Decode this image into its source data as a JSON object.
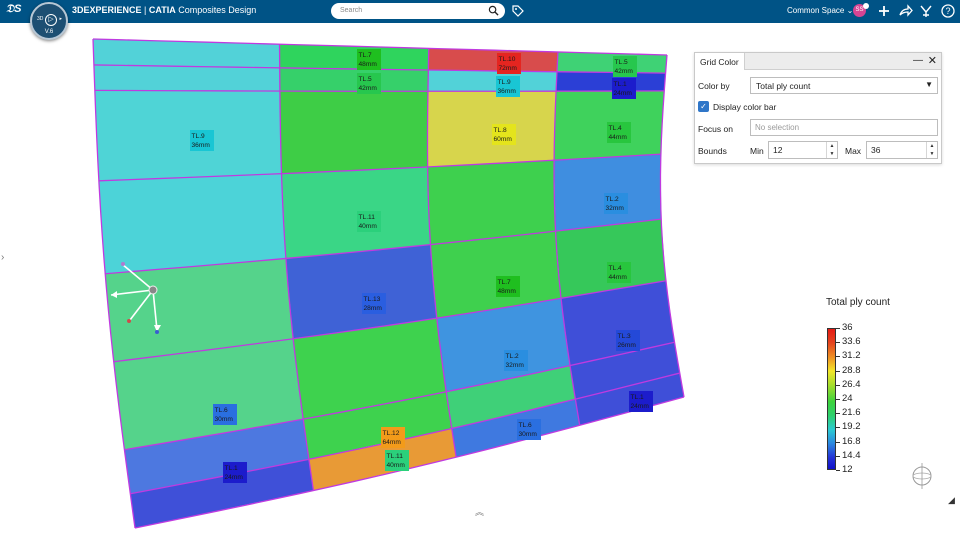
{
  "header": {
    "brand_bold": "3DEXPERIENCE",
    "brand_sep": " | ",
    "brand_app": "CATIA",
    "brand_module": " Composites Design",
    "search_placeholder": "Search",
    "space_label": "Common Space",
    "avatar_initials": "SS",
    "compass_version": "V.6",
    "compass_3d": "3D",
    "compass_play": "▷"
  },
  "icons": {
    "search": "search-icon",
    "tag": "tag-icon",
    "add": "plus-icon",
    "share": "share-icon",
    "tools": "tools-icon",
    "help": "help-icon"
  },
  "grid_color_panel": {
    "title": "Grid Color",
    "minimize": "—",
    "close": "✕",
    "color_by_label": "Color by",
    "color_by_value": "Total ply count",
    "display_color_bar_label": "Display color bar",
    "display_color_bar_checked": true,
    "focus_on_label": "Focus on",
    "focus_on_placeholder": "No selection",
    "bounds_label": "Bounds",
    "min_label": "Min",
    "min_value": "12",
    "max_label": "Max",
    "max_value": "36"
  },
  "color_bar": {
    "title": "Total ply count",
    "ticks": [
      "36",
      "33.6",
      "31.2",
      "28.8",
      "26.4",
      "24",
      "21.6",
      "19.2",
      "16.8",
      "14.4",
      "12"
    ],
    "min": 12,
    "max": 36
  },
  "ply_labels": [
    {
      "name": "TL.7",
      "thickness": "48mm",
      "color": "#1fbf1f"
    },
    {
      "name": "TL.10",
      "thickness": "72mm",
      "color": "#e52520"
    },
    {
      "name": "TL.5",
      "thickness": "42mm",
      "color": "#27c74e"
    },
    {
      "name": "TL.5",
      "thickness": "42mm",
      "color": "#27c74e"
    },
    {
      "name": "TL.9",
      "thickness": "36mm",
      "color": "#19c6d4"
    },
    {
      "name": "TL.1",
      "thickness": "24mm",
      "color": "#1c1ccc"
    },
    {
      "name": "TL.9",
      "thickness": "36mm",
      "color": "#19c6d4"
    },
    {
      "name": "TL.8",
      "thickness": "60mm",
      "color": "#e4e41c"
    },
    {
      "name": "TL.4",
      "thickness": "44mm",
      "color": "#28c63e"
    },
    {
      "name": "TL.2",
      "thickness": "32mm",
      "color": "#2a8ee0"
    },
    {
      "name": "TL.11",
      "thickness": "40mm",
      "color": "#2bd07b"
    },
    {
      "name": "TL.4",
      "thickness": "44mm",
      "color": "#28c63e"
    },
    {
      "name": "TL.7",
      "thickness": "48mm",
      "color": "#1fbf1f"
    },
    {
      "name": "TL.13",
      "thickness": "28mm",
      "color": "#2a5ee0"
    },
    {
      "name": "TL.3",
      "thickness": "26mm",
      "color": "#2449d8"
    },
    {
      "name": "TL.2",
      "thickness": "32mm",
      "color": "#2a8ee0"
    },
    {
      "name": "TL.1",
      "thickness": "24mm",
      "color": "#1c1ccc"
    },
    {
      "name": "TL.6",
      "thickness": "30mm",
      "color": "#2a6fe0"
    },
    {
      "name": "TL.6",
      "thickness": "30mm",
      "color": "#2a6fe0"
    },
    {
      "name": "TL.12",
      "thickness": "64mm",
      "color": "#f39b1a"
    },
    {
      "name": "TL.11",
      "thickness": "40mm",
      "color": "#2bd07b"
    },
    {
      "name": "TL.1",
      "thickness": "24mm",
      "color": "#1c1ccc"
    }
  ],
  "colors": {
    "header_bg": "#005386",
    "grid_line": "#c040e0",
    "accent_blue": "#2f76c8"
  }
}
